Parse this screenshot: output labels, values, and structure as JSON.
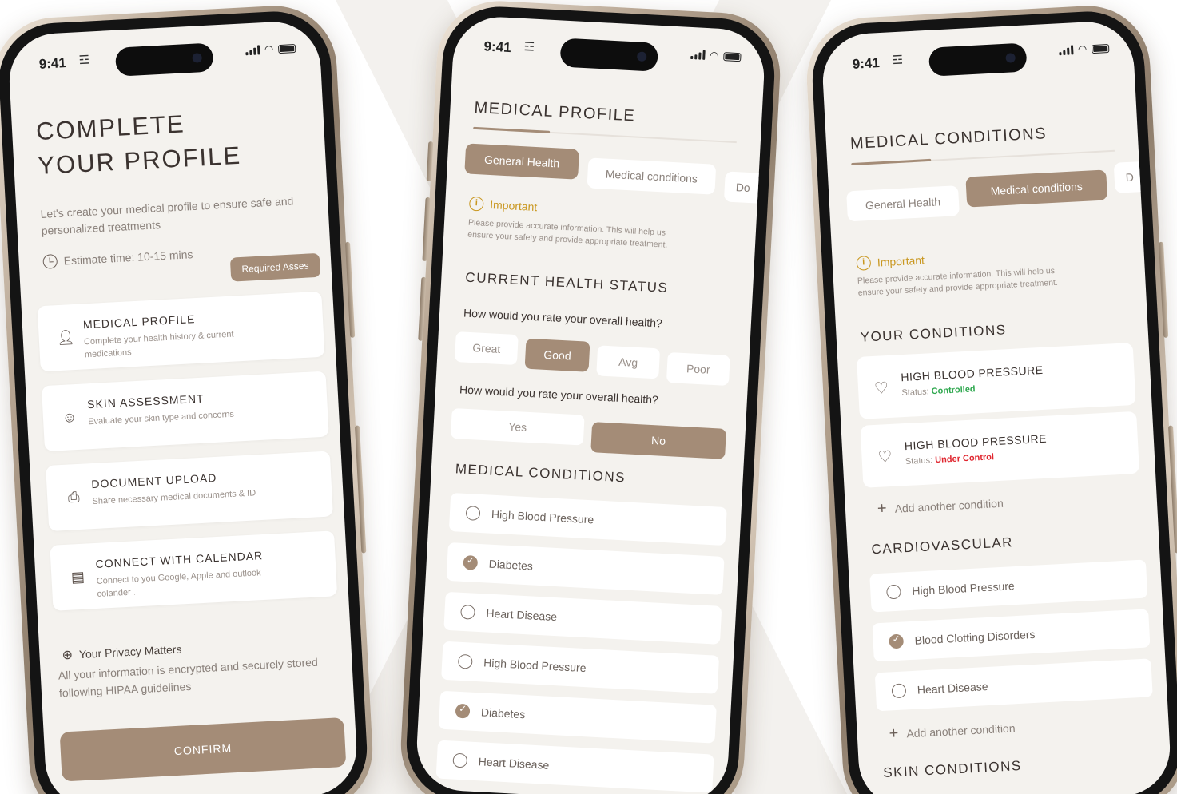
{
  "status_bar": {
    "time": "9:41"
  },
  "phone1": {
    "title_line1": "COMPLETE",
    "title_line2": "YOUR PROFILE",
    "subtitle": "Let's create your medical profile to ensure safe and personalized treatments",
    "estimate": "Estimate time: 10-15 mins",
    "required_badge": "Required Asses",
    "cards": [
      {
        "title": "MEDICAL PROFILE",
        "desc": "Complete your health history & current medications",
        "icon": "person-icon"
      },
      {
        "title": "SKIN ASSESSMENT",
        "desc": "Evaluate your skin type and concerns",
        "icon": "smile-icon"
      },
      {
        "title": "DOCUMENT UPLOAD",
        "desc": "Share necessary medical documents & ID",
        "icon": "document-icon"
      },
      {
        "title": "CONNECT WITH CALENDAR",
        "desc": "Connect to you Google, Apple and outlook colander .",
        "icon": "calendar-icon"
      }
    ],
    "privacy_title": "Your Privacy Matters",
    "privacy_body": "All your information is encrypted and securely stored following HIPAA guidelines",
    "confirm": "CONFIRM"
  },
  "phone2": {
    "title": "MEDICAL PROFILE",
    "tabs": [
      "General Health",
      "Medical conditions",
      "Do"
    ],
    "important_label": "Important",
    "important_desc": "Please provide accurate information. This will help us ensure your safety and provide appropriate treatment.",
    "section_health": "CURRENT HEALTH STATUS",
    "q1": "How would you rate your overall health?",
    "q1_options": [
      "Great",
      "Good",
      "Avg",
      "Poor"
    ],
    "q1_selected": "Good",
    "q2": "How would you rate your overall health?",
    "q2_options": [
      "Yes",
      "No"
    ],
    "q2_selected": "No",
    "section_conditions": "MEDICAL CONDITIONS",
    "conditions": [
      {
        "label": "High Blood Pressure",
        "checked": false
      },
      {
        "label": "Diabetes",
        "checked": true
      },
      {
        "label": "Heart Disease",
        "checked": false
      },
      {
        "label": "High Blood Pressure",
        "checked": false
      },
      {
        "label": "Diabetes",
        "checked": true
      },
      {
        "label": "Heart Disease",
        "checked": false
      }
    ]
  },
  "phone3": {
    "title": "MEDICAL CONDITIONS",
    "tabs": [
      "General Health",
      "Medical conditions",
      "D"
    ],
    "important_label": "Important",
    "important_desc": "Please provide accurate information. This will help us ensure your safety and provide appropriate treatment.",
    "section_your": "YOUR CONDITIONS",
    "your_conditions": [
      {
        "title": "HIGH BLOOD PRESSURE",
        "status_label": "Status:",
        "status": "Controlled",
        "status_color": "#2fa84f"
      },
      {
        "title": "HIGH BLOOD PRESSURE",
        "status_label": "Status:",
        "status": "Under Control",
        "status_color": "#e0262f"
      }
    ],
    "add_condition": "Add another condition",
    "section_cardio": "CARDIOVASCULAR",
    "cardio": [
      {
        "label": "High Blood Pressure",
        "checked": false
      },
      {
        "label": "Blood Clotting Disorders",
        "checked": true
      },
      {
        "label": "Heart Disease",
        "checked": false
      }
    ],
    "add_condition_2": "Add another condition",
    "section_skin": "SKIN CONDITIONS"
  },
  "colors": {
    "accent": "#a48c77",
    "background": "#f4f2ee",
    "important": "#c9971f"
  }
}
